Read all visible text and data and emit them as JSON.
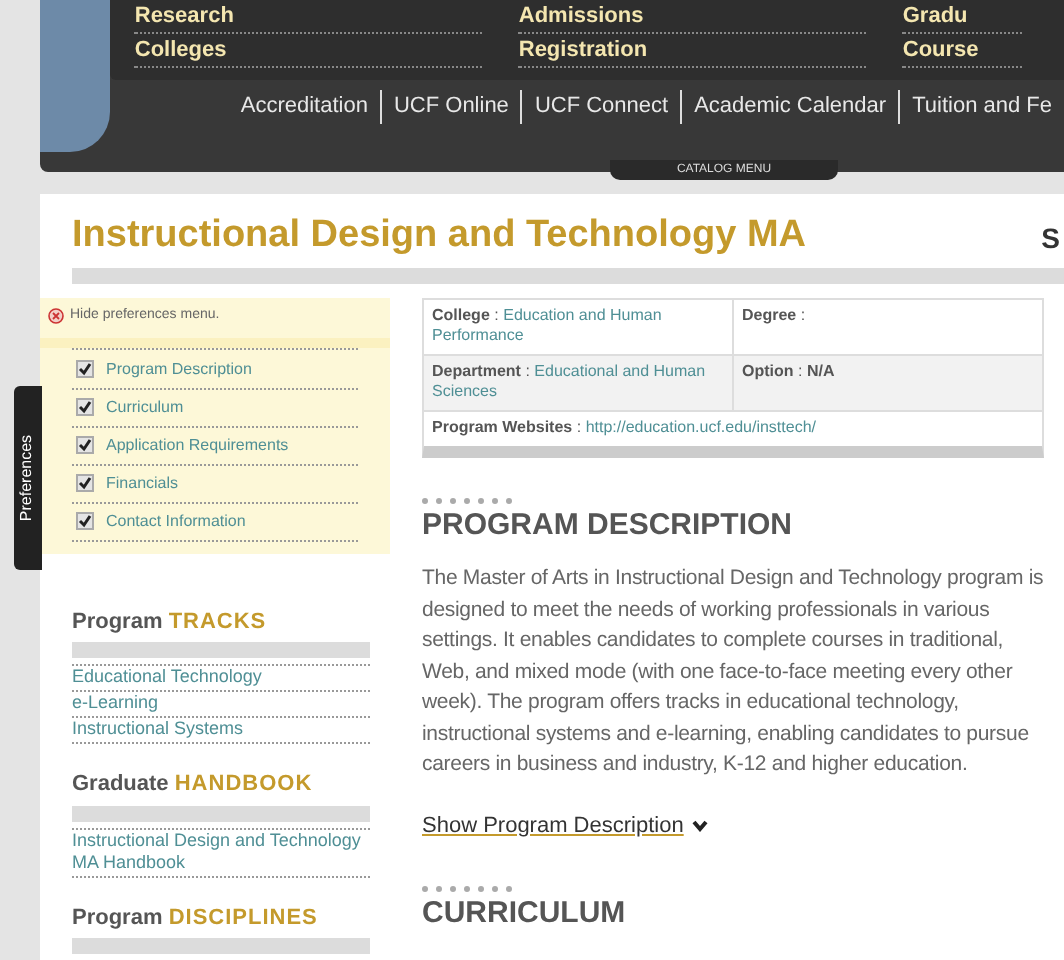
{
  "header": {
    "nav_columns": [
      {
        "items": [
          "Research",
          "Colleges"
        ]
      },
      {
        "items": [
          "Admissions",
          "Registration"
        ]
      },
      {
        "items": [
          "Gradu",
          "Course"
        ]
      }
    ],
    "quick_links": [
      "Accreditation",
      "UCF Online",
      "UCF Connect",
      "Academic Calendar",
      "Tuition and Fe"
    ],
    "catalog_menu": "CATALOG MENU"
  },
  "page_title": "Instructional Design and Technology MA",
  "right_edge_text": "S",
  "preferences": {
    "tab_label": "Preferences",
    "hide_label": "Hide preferences menu.",
    "items": [
      {
        "label": "Program Description",
        "checked": true
      },
      {
        "label": "Curriculum",
        "checked": true
      },
      {
        "label": "Application Requirements",
        "checked": true
      },
      {
        "label": "Financials",
        "checked": true
      },
      {
        "label": "Contact Information",
        "checked": true
      }
    ]
  },
  "sidebar_sections": [
    {
      "prefix": "Program",
      "title": "TRACKS",
      "links": [
        "Educational Technology",
        "e-Learning",
        "Instructional Systems"
      ]
    },
    {
      "prefix": "Graduate",
      "title": "HANDBOOK",
      "links": [
        "Instructional Design and Technology MA Handbook"
      ]
    },
    {
      "prefix": "Program",
      "title": "DISCIPLINES"
    }
  ],
  "info_table": {
    "separator": ":",
    "rows": [
      [
        {
          "label": "College",
          "value": "Education and Human Performance",
          "kind": "link"
        },
        {
          "label": "Degree"
        }
      ],
      [
        {
          "label": "Department",
          "value": "Educational and Human Sciences",
          "kind": "link"
        },
        {
          "label": "Option",
          "value": "N/A",
          "kind": "plain"
        }
      ],
      [
        {
          "label": "Program Websites",
          "value": "http://education.ucf.edu/insttech/",
          "kind": "link"
        }
      ]
    ]
  },
  "sections": [
    {
      "heading": "PROGRAM DESCRIPTION",
      "body": "The Master of Arts in Instructional Design and Technology program is designed to meet the needs of working professionals in various settings. It enables candidates to complete courses in traditional, Web, and mixed mode (with one face-to-face meeting every other week). The program offers tracks in educational technology, instructional systems and e-learning, enabling candidates to pursue careers in business and industry, K-12 and higher education.",
      "toggle": "Show Program Description"
    },
    {
      "heading": "CURRICULUM"
    }
  ]
}
